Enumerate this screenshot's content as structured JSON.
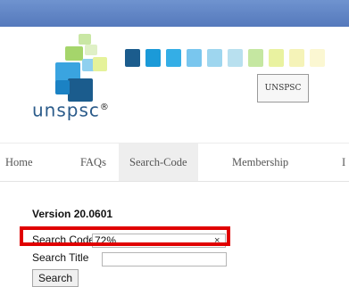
{
  "header": {
    "brand": "unspsc",
    "brand_mark": "®",
    "badge": "UNSPSC"
  },
  "nav": {
    "items": [
      "Home",
      "FAQs",
      "Search-Code",
      "Membership",
      "I"
    ],
    "active": "Search-Code"
  },
  "form": {
    "version": "Version 20.0601",
    "search_code_label": "Search Code",
    "search_code_value": "72%",
    "clear_glyph": "×",
    "search_title_label": "Search Title",
    "search_title_value": "",
    "search_button": "Search"
  },
  "colors": {
    "topbar": "#5e82c4",
    "highlight": "#e00000",
    "brand_text": "#2b5b8a"
  }
}
